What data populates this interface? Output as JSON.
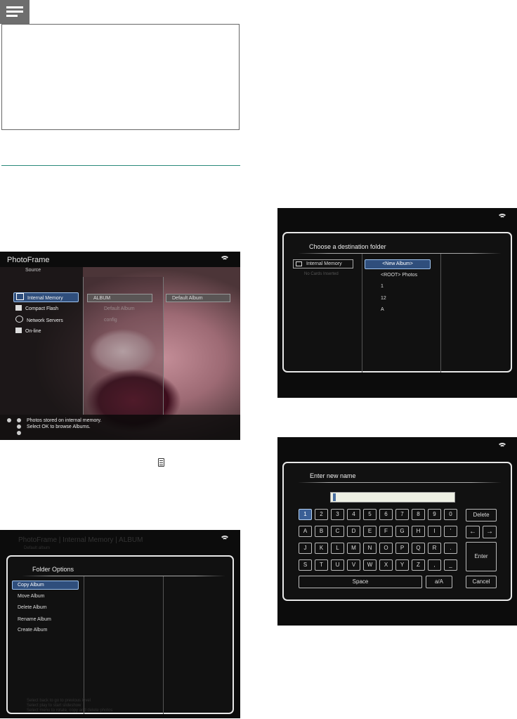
{
  "screen1": {
    "title": "PhotoFrame",
    "subtitle": "Source",
    "sources": [
      {
        "label": "Internal Memory",
        "icon": "internal-memory-icon"
      },
      {
        "label": "Compact Flash",
        "icon": "compact-flash-icon"
      },
      {
        "label": "Network Servers",
        "icon": "globe-icon"
      },
      {
        "label": "On-line",
        "icon": "rss-icon"
      }
    ],
    "albums": [
      "ALBUM",
      "Default Album",
      "config"
    ],
    "preview": "Default Album",
    "status_lines": [
      "Photos stored on internal memory.",
      "Select OK to browse Albums."
    ]
  },
  "screen2": {
    "header": "PhotoFrame | Internal Memory | ALBUM",
    "header_sub": "Default album",
    "title": "Folder Options",
    "options": [
      "Copy Album",
      "Move Album",
      "Delete Album",
      "Rename Album",
      "Create Album"
    ],
    "status_lines": [
      "Select back to go to previous level",
      "Select play to start slideshow",
      "Select menu to rotate, copy and delete photos"
    ]
  },
  "screen3": {
    "title": "Choose a destination folder",
    "source": "Internal Memory",
    "source_note": "No Cards Inserted",
    "folders": [
      "<New Album>",
      "<ROOT> Photos",
      "1",
      "12",
      "A"
    ]
  },
  "screen4": {
    "title": "Enter new name",
    "input_value": "",
    "rows": [
      [
        "1",
        "2",
        "3",
        "4",
        "5",
        "6",
        "7",
        "8",
        "9",
        "0"
      ],
      [
        "A",
        "B",
        "C",
        "D",
        "E",
        "F",
        "G",
        "H",
        "I",
        "'"
      ],
      [
        "J",
        "K",
        "L",
        "M",
        "N",
        "O",
        "P",
        "Q",
        "R",
        "."
      ],
      [
        "S",
        "T",
        "U",
        "V",
        "W",
        "X",
        "Y",
        "Z",
        ",",
        "_"
      ]
    ],
    "space": "Space",
    "case": "a/A",
    "delete": "Delete",
    "enter": "Enter",
    "cancel": "Cancel",
    "arrow_left": "←",
    "arrow_right": "→"
  }
}
